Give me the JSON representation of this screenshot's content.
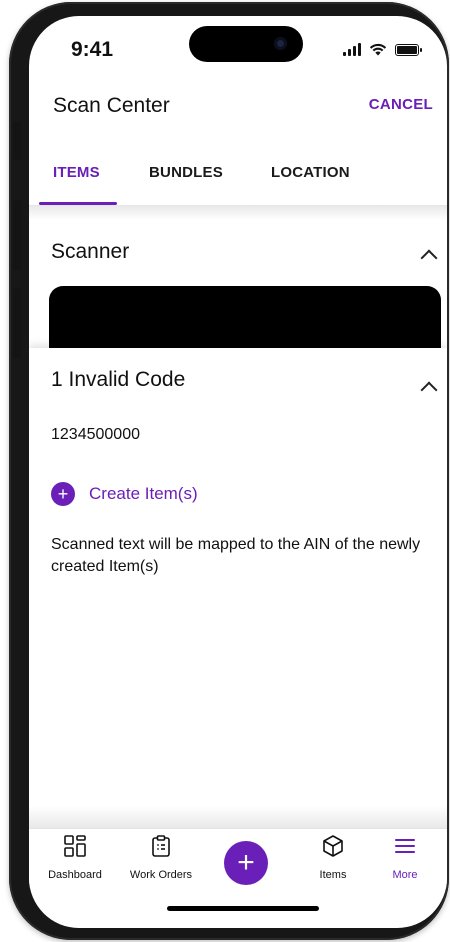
{
  "status_bar": {
    "time": "9:41"
  },
  "header": {
    "title": "Scan Center",
    "cancel_label": "CANCEL"
  },
  "tabs": [
    {
      "label": "ITEMS",
      "active": true
    },
    {
      "label": "BUNDLES",
      "active": false
    },
    {
      "label": "LOCATION",
      "active": false
    }
  ],
  "scanner": {
    "title": "Scanner",
    "expanded": true
  },
  "invalid_codes": {
    "title": "1 Invalid Code",
    "codes": [
      "1234500000"
    ],
    "create_label": "Create Item(s)",
    "helper_text": "Scanned text will be mapped to the AIN of the newly created Item(s)"
  },
  "bottom_nav": {
    "items": [
      {
        "label": "Dashboard",
        "icon": "dashboard-grid-icon"
      },
      {
        "label": "Work Orders",
        "icon": "clipboard-icon"
      },
      {
        "label": "Items",
        "icon": "box-icon"
      },
      {
        "label": "More",
        "icon": "hamburger-menu-icon"
      }
    ],
    "fab_icon": "plus-icon"
  },
  "colors": {
    "accent": "#6a1fb8",
    "text": "#111111",
    "scanner_background": "#000000"
  }
}
